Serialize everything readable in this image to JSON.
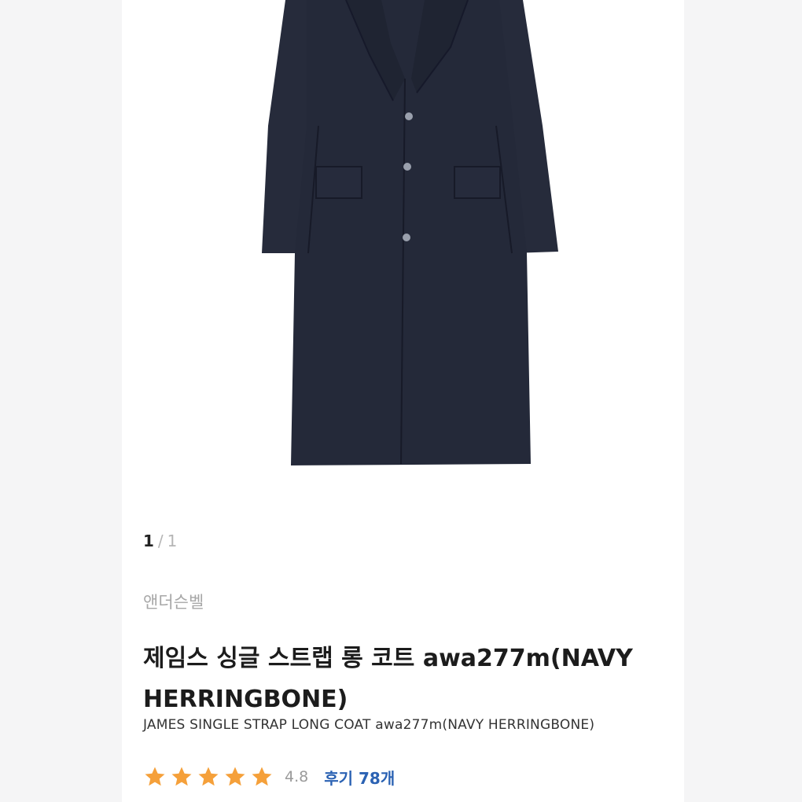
{
  "gallery": {
    "current_index": "1",
    "separator": "/",
    "total": "1",
    "image_subject": "navy herringbone long coat"
  },
  "product": {
    "brand": "앤더슨벨",
    "title": "제임스 싱글 스트랩 롱 코트 awa277m(NAVY HERRINGBONE)",
    "subtitle": "JAMES SINGLE STRAP LONG COAT awa277m(NAVY HERRINGBONE)",
    "rating": "4.8",
    "rating_stars": 5,
    "review_link": "후기 78개"
  },
  "colors": {
    "star": "#f5a03a",
    "review_link": "#2b62b3",
    "coat": "#252a3a"
  }
}
